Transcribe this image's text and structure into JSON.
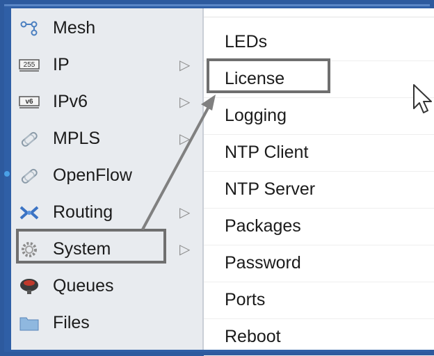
{
  "left_menu": {
    "items": [
      {
        "label": "Mesh",
        "icon": "mesh-icon",
        "has_submenu": false
      },
      {
        "label": "IP",
        "icon": "ip-icon",
        "badge": "255",
        "has_submenu": true
      },
      {
        "label": "IPv6",
        "icon": "ipv6-icon",
        "badge": "v6",
        "has_submenu": true
      },
      {
        "label": "MPLS",
        "icon": "mpls-icon",
        "has_submenu": true
      },
      {
        "label": "OpenFlow",
        "icon": "openflow-icon",
        "has_submenu": false
      },
      {
        "label": "Routing",
        "icon": "routing-icon",
        "has_submenu": true
      },
      {
        "label": "System",
        "icon": "system-gear-icon",
        "has_submenu": true,
        "highlighted": true
      },
      {
        "label": "Queues",
        "icon": "queues-icon",
        "has_submenu": false
      },
      {
        "label": "Files",
        "icon": "files-icon",
        "has_submenu": false
      }
    ]
  },
  "submenu": {
    "items": [
      {
        "label": "LEDs"
      },
      {
        "label": "License",
        "highlighted": true
      },
      {
        "label": "Logging"
      },
      {
        "label": "NTP Client"
      },
      {
        "label": "NTP Server"
      },
      {
        "label": "Packages"
      },
      {
        "label": "Password"
      },
      {
        "label": "Ports"
      },
      {
        "label": "Reboot"
      }
    ]
  },
  "colors": {
    "background": "#2d5a9e",
    "menu_bg": "#e8ebef",
    "highlight_box": "#6f6f6f",
    "annotation_arrow": "#808080"
  }
}
